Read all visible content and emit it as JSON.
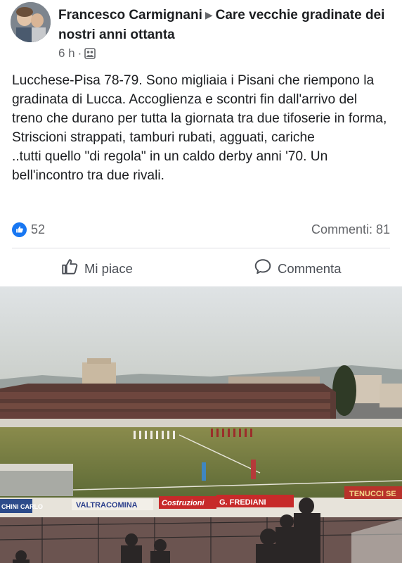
{
  "post": {
    "author": "Francesco Carmignani",
    "group": "Care vecchie gradinate dei nostri anni ottanta",
    "time": "6 h",
    "separator": "·",
    "text": "Lucchese-Pisa 78-79. Sono migliaia i Pisani che riempono la gradinata di Lucca. Accoglienza e scontri fin dall'arrivo del treno che durano per tutta la giornata tra due tifoserie in forma, Striscioni strappati, tamburi rubati, agguati, cariche\n..tutti quello \"di regola\" in un caldo derby anni '70. Un bell'incontro tra due rivali."
  },
  "stats": {
    "likes": "52",
    "comments": "Commenti: 81"
  },
  "actions": {
    "like_label": "Mi piace",
    "comment_label": "Commenta"
  },
  "photo": {
    "banners": {
      "left_ad": "CHINI CARLO",
      "ad_1": "VALTRACOMINA",
      "ad_2": "Costruzioni",
      "ad_3": "G. FREDIANI",
      "ad_4": "TENUCCI SE"
    }
  },
  "colors": {
    "accent": "#1877f2",
    "text": "#1c1e21",
    "secondary": "#65676b"
  },
  "icons": {
    "privacy": "group-icon",
    "reaction": "thumbs-up-icon",
    "like_action": "thumbs-up-outline-icon",
    "comment_action": "speech-bubble-icon"
  }
}
